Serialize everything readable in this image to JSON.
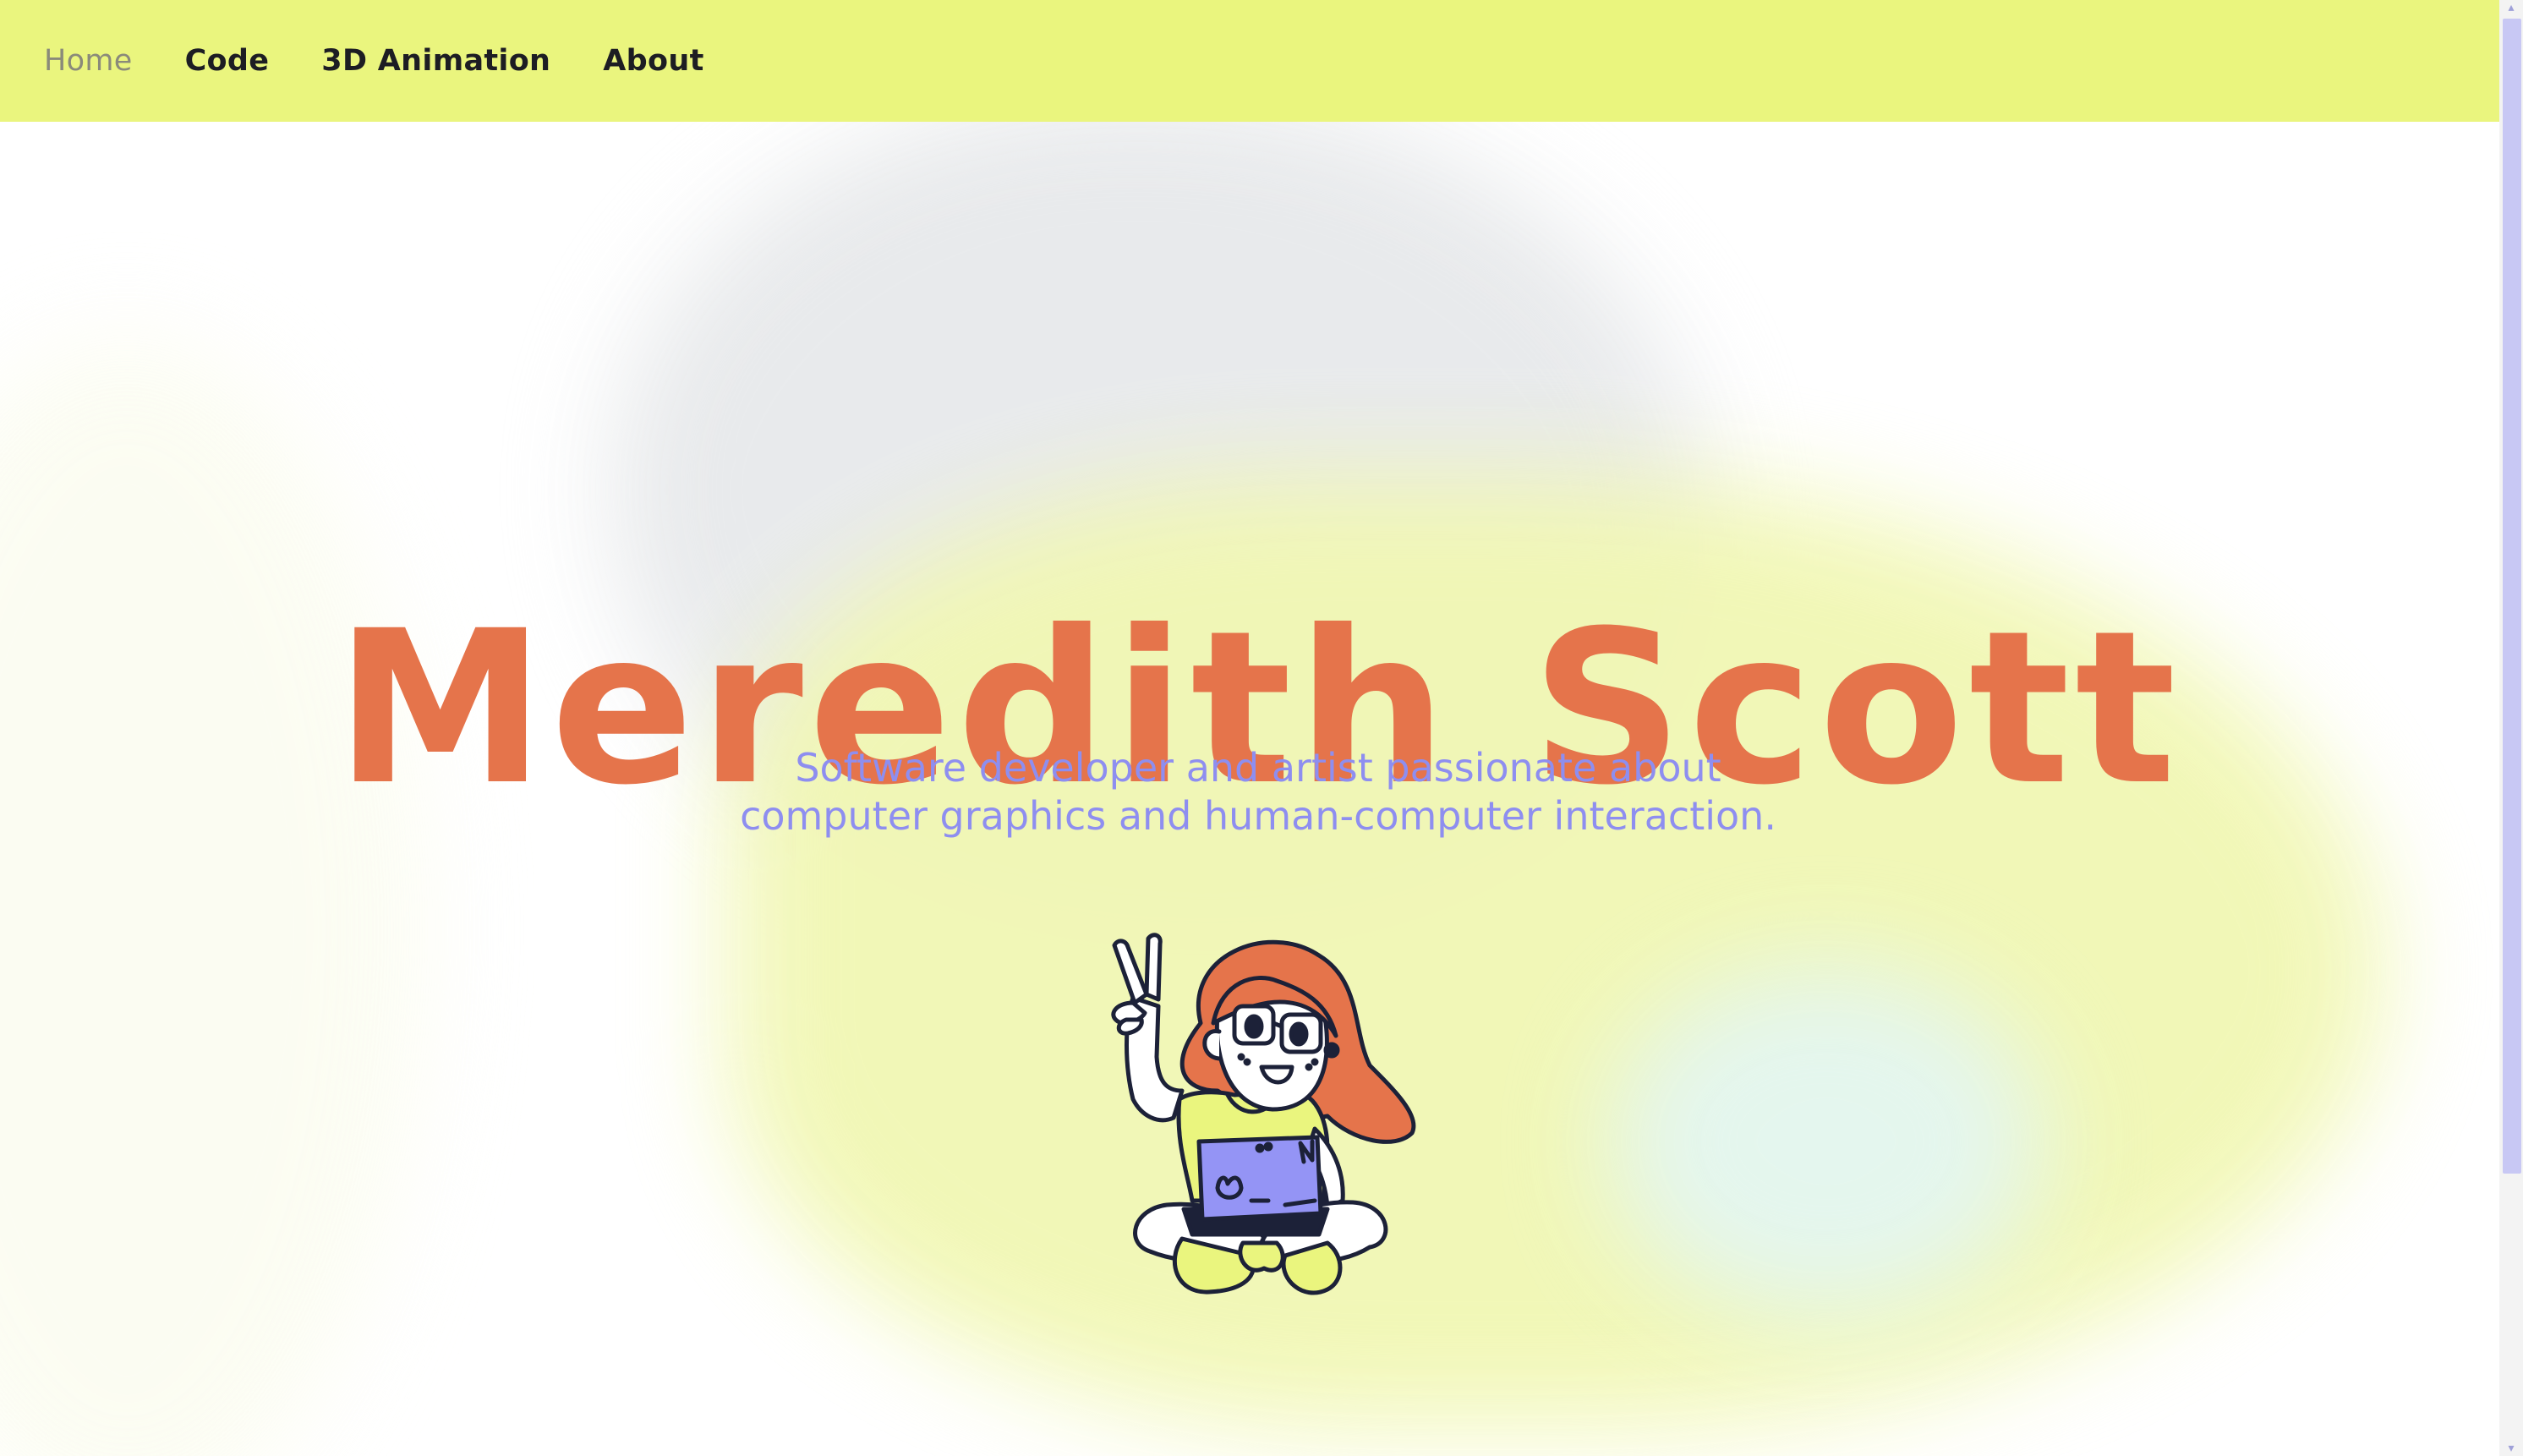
{
  "nav": {
    "items": [
      {
        "label": "Home",
        "active": true
      },
      {
        "label": "Code",
        "active": false
      },
      {
        "label": "3D Animation",
        "active": false
      },
      {
        "label": "About",
        "active": false
      }
    ]
  },
  "hero": {
    "title": "Meredith Scott",
    "subtitle": "Software developer and artist passionate about computer graphics and human-computer interaction."
  },
  "illustration": {
    "icon": "girl-with-laptop-peace-sign-illustration"
  },
  "colors": {
    "nav_background": "#eaf57e",
    "title": "#e5744b",
    "subtitle": "#8e8ef0",
    "scrollbar_thumb": "#c8c8f4"
  }
}
